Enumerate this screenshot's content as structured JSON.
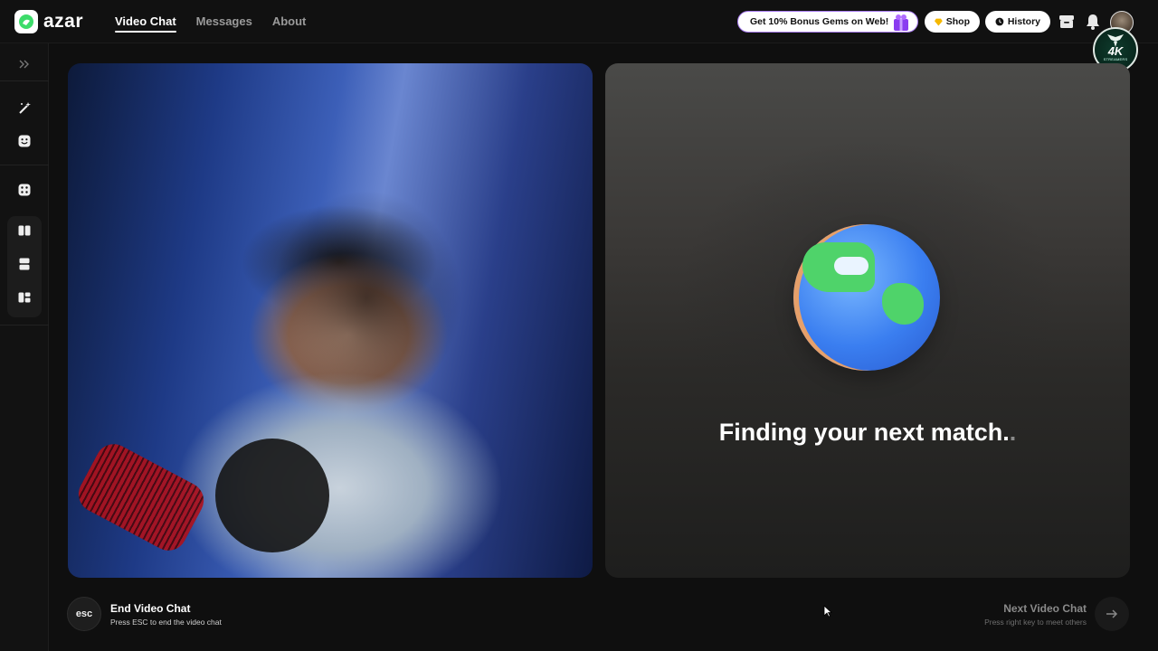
{
  "header": {
    "logo_text": "azar",
    "nav": [
      {
        "label": "Video Chat",
        "active": true
      },
      {
        "label": "Messages",
        "active": false
      },
      {
        "label": "About",
        "active": false
      }
    ],
    "promo_label": "Get 10% Bonus Gems on Web!",
    "shop_label": "Shop",
    "history_label": "History",
    "badge": {
      "title": "4K",
      "subtitle": "STREAMERS"
    }
  },
  "sidebar": {
    "icons": [
      "expand-icon",
      "magic-wand-icon",
      "face-filter-icon",
      "dice-icon",
      "layout-split-vertical-icon",
      "layout-split-horizontal-icon",
      "layout-grid-icon"
    ]
  },
  "match": {
    "finding_text": "Finding your next match",
    "finding_dots": "."
  },
  "controls": {
    "esc_key": "esc",
    "end_title": "End Video Chat",
    "end_sub": "Press ESC to end the video chat",
    "next_title": "Next Video Chat",
    "next_sub": "Press right key to meet others"
  },
  "colors": {
    "accent_green": "#3ddc6a",
    "promo_border": "#a87cf0",
    "background": "#0f0f0f"
  }
}
